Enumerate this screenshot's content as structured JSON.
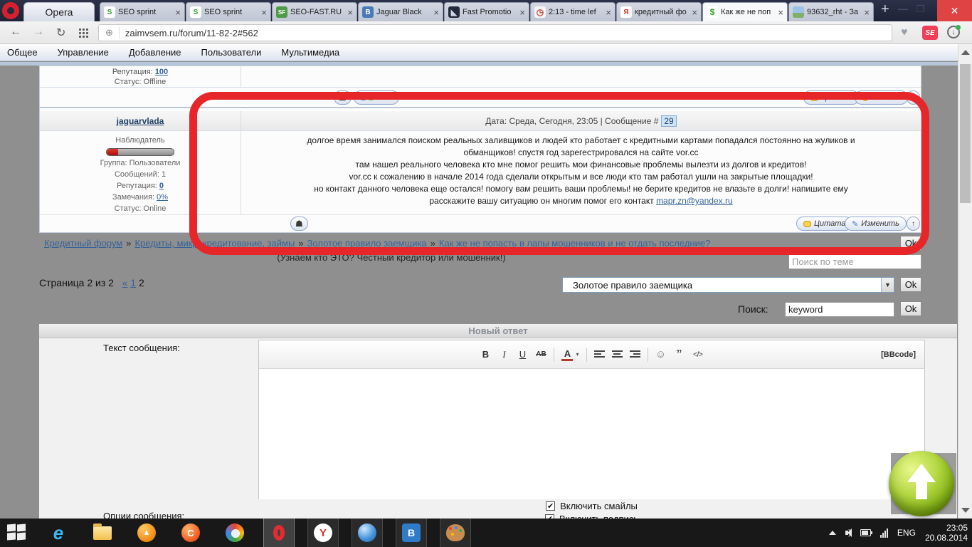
{
  "colors": {
    "annotation_red": "#e62628",
    "link_blue": "#36639a",
    "ucoz_button_border": "#8fa8cc",
    "taskbar_bg": "#181818",
    "tabbar_bg": "#1e2336",
    "green_button": "#84b315",
    "close_button_red": "#e04343"
  },
  "browser": {
    "opera_label": "Opera",
    "tab_close": "×",
    "new_tab": "+",
    "win_min": "—",
    "win_max": "❐",
    "win_close": "✕",
    "nav_back": "←",
    "nav_forward": "→",
    "nav_reload": "↻",
    "globe": "⊕",
    "url": "zaimvsem.ru/forum/11-82-2#562",
    "heart": "♥",
    "se_badge": "SE",
    "download_arrow": "↓",
    "tabs": [
      {
        "title": "SEO sprint",
        "glyph": "S"
      },
      {
        "title": "SEO sprint",
        "glyph": "S"
      },
      {
        "title": "SEO-FAST.RU",
        "glyph": "SF"
      },
      {
        "title": "Jaguar Black",
        "glyph": "B"
      },
      {
        "title": "Fast Promotio",
        "glyph": "◣"
      },
      {
        "title": "2:13 - time lef",
        "glyph": "◷"
      },
      {
        "title": "кредитный фо",
        "glyph": "Я"
      },
      {
        "title": "Как же не поп",
        "glyph": "$"
      },
      {
        "title": "93632_rht - За",
        "glyph": ""
      }
    ]
  },
  "admin_menu": {
    "items": [
      "Общее",
      "Управление",
      "Добавление",
      "Пользователи",
      "Мультимедиа"
    ]
  },
  "prev_post": {
    "rep_label": "Репутация:",
    "rep_value": "100",
    "status": "Статус: Offline",
    "pm_label": "Л.С.",
    "quote_label": "Цитата",
    "report_label": "Жалоба",
    "report_icon": "!",
    "person_icon": "☗"
  },
  "post": {
    "author": "jaguarvlada",
    "rank": "Наблюдатель",
    "group": "Группа: Пользователи",
    "messages": "Сообщений: 1",
    "rep_label": "Репутация:",
    "rep_value": "0",
    "remarks_label": "Замечания:",
    "remarks_value": "0%",
    "status": "Статус: Online",
    "date_prefix": "Дата: Среда, Сегодня, 23:05 | Сообщение #",
    "number": "29",
    "lines": [
      "долгое время занимался поиском реальных заливщиков и людей кто работает с кредитными картами попадался постоянно на жуликов и",
      "обманщиков! спустя год зарегестрировался на сайте vor.cc",
      "там нашел реального человека кто мне помог решить мои финансовые проблемы вылезти из долгов и кредитов!",
      "vor.cc к сожалению в начале 2014 года сделали открытым и все люди кто там работал ушли на закрытые площадки!",
      "но контакт данного человека еще остался! помогу вам решить ваши проблемы! не берите кредитов не влазьте в долги! напишите ему",
      "расскажите вашу ситуацию он многим помог его контакт"
    ],
    "email": "mapr.zn@yandex.ru",
    "quote_label": "Цитата",
    "edit_label": "Изменить",
    "edit_icon": "✎",
    "person_icon": "☗",
    "up_icon": "↑"
  },
  "breadcrumbs": {
    "sep": "»",
    "items": [
      "Кредитный форум",
      "Кредиты, микрокредитование, займы",
      "Золотое правило заемщика",
      "Как же не попасть в лапы мошенников и не отдать последние?"
    ],
    "subtitle": "(Узнаем кто ЭТО? Честный кредитор или мошенник!)"
  },
  "topic_search": {
    "ok": "Ok",
    "placeholder": "Поиск по теме"
  },
  "pagination": {
    "label": "Страница 2 из 2",
    "prev": "«",
    "page1": "1",
    "page2": "2"
  },
  "jump": {
    "value": "Золотое правило заемщика",
    "caret": "▼",
    "ok": "Ok"
  },
  "search": {
    "label": "Поиск:",
    "value": "keyword",
    "ok": "Ok"
  },
  "reply_form": {
    "title": "Новый ответ",
    "message_label": "Текст сообщения:",
    "options_label": "Опции сообщения:",
    "bbcode": "[BBcode]",
    "smiles_checkbox": "Включить смайлы",
    "sign_checkbox": "Включить подпись",
    "check_glyph": "✔",
    "toolbar": {
      "bold": "B",
      "italic": "I",
      "underline": "U",
      "strike": "AB",
      "color": "A",
      "color_caret": "▾",
      "smiley": "☺",
      "quote": "”",
      "code": "</>"
    }
  },
  "taskbar": {
    "ie_glyph": "e",
    "orange_glyph": "▲",
    "flame_glyph": "C",
    "yandex_glyph": "Y",
    "vk_glyph": "В",
    "lang": "ENG",
    "time": "23:05",
    "date": "20.08.2014"
  }
}
